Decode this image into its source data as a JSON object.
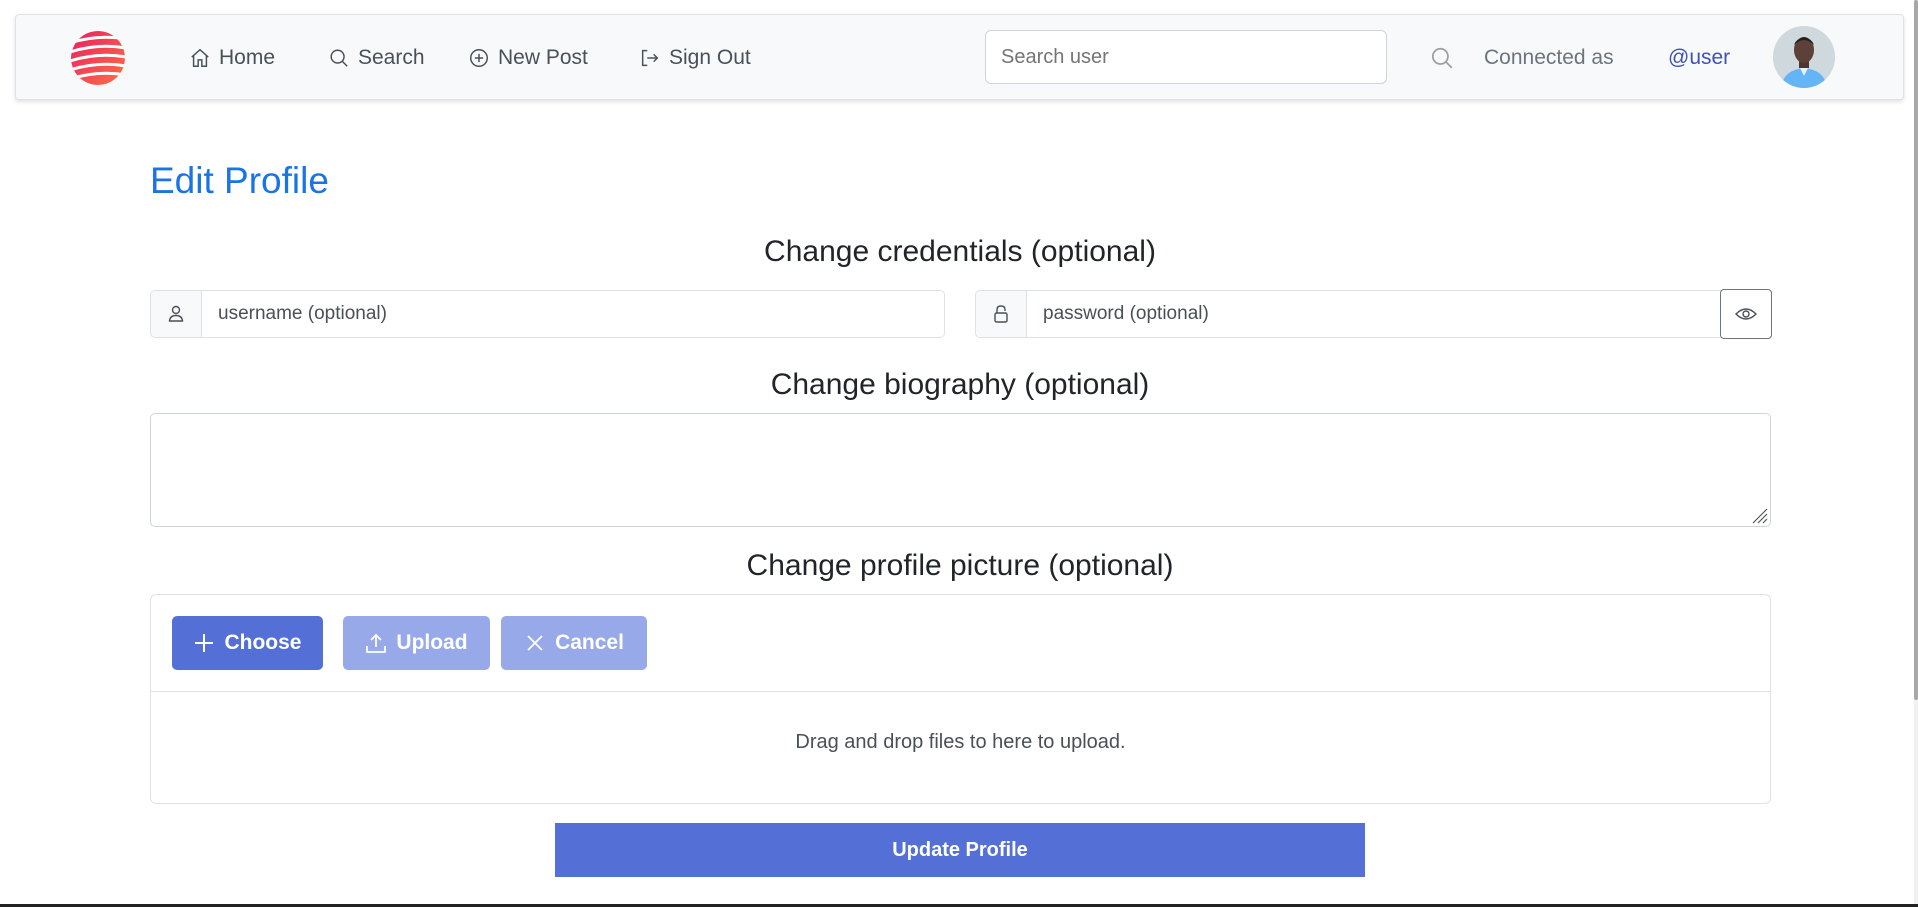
{
  "nav": {
    "items": [
      {
        "label": "Home",
        "icon": "home-icon"
      },
      {
        "label": "Search",
        "icon": "search-icon"
      },
      {
        "label": "New Post",
        "icon": "plus-circle-icon"
      },
      {
        "label": "Sign Out",
        "icon": "sign-out-icon"
      }
    ],
    "search_placeholder": "Search user",
    "connected_label": "Connected as",
    "username": "@user"
  },
  "page": {
    "title": "Edit Profile",
    "credentials_heading": "Change credentials (optional)",
    "username_placeholder": "username (optional)",
    "password_placeholder": "password (optional)",
    "biography_heading": "Change biography (optional)",
    "biography_value": "",
    "picture_heading": "Change profile picture (optional)",
    "choose_label": "Choose",
    "upload_label": "Upload",
    "cancel_label": "Cancel",
    "drop_text": "Drag and drop files to here to upload.",
    "update_label": "Update Profile"
  },
  "colors": {
    "primary": "#5470d6",
    "primary_disabled": "#98a9e9",
    "title_blue": "#1b74e4",
    "link_blue": "#3f51b5"
  }
}
